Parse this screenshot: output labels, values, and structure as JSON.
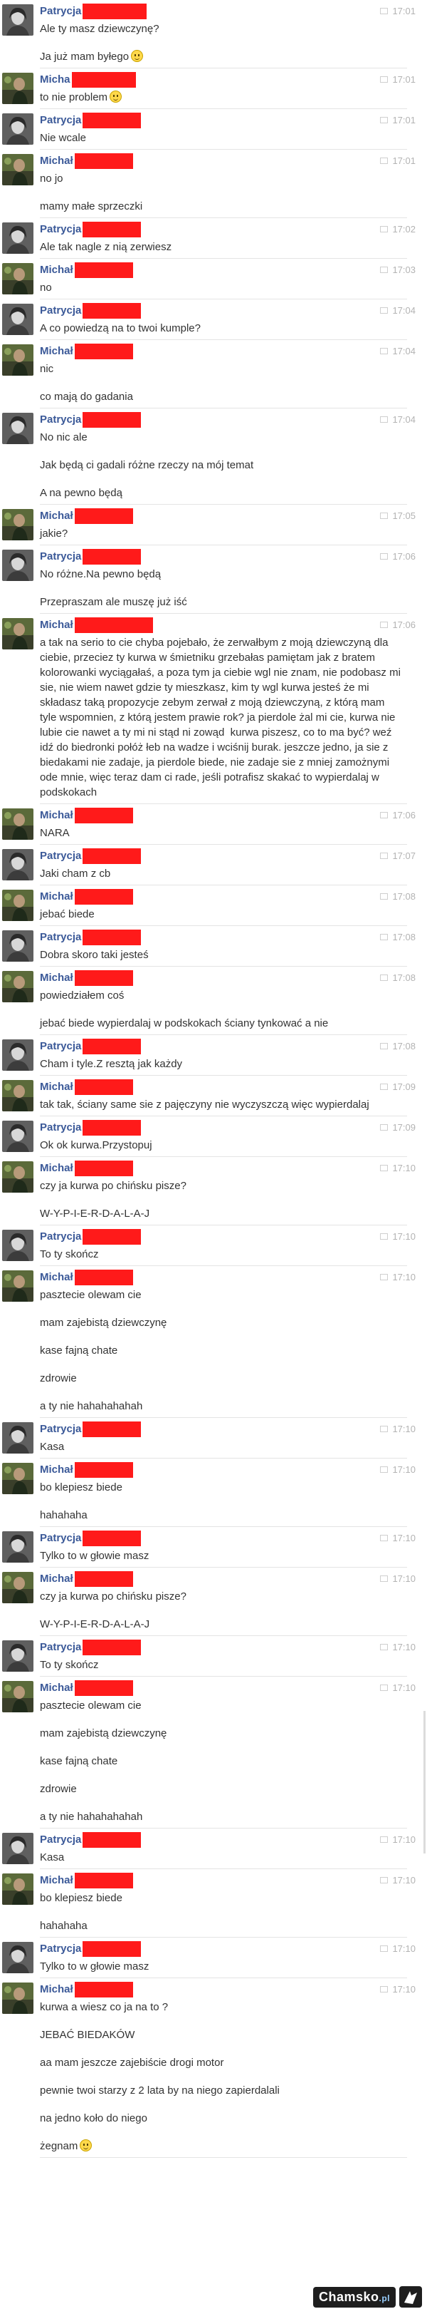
{
  "colors": {
    "sender_name": "#3b5998",
    "redaction": "#ff1a1a",
    "timestamp": "#b3b3b3",
    "message_text": "#333333"
  },
  "messages": [
    {
      "sender": "Patrycja",
      "time": "17:01",
      "avatar": "avatar-patrycja",
      "redact_w": 90,
      "texts": [
        "Ale ty masz dziewczynę?",
        "Ja już mam byłego"
      ],
      "emoji_last": true
    },
    {
      "sender": "Micha",
      "time": "17:01",
      "avatar": "avatar-michal",
      "redact_w": 90,
      "texts": [
        "to nie problem"
      ]
    },
    {
      "sender": "Patrycja",
      "time": "17:01",
      "avatar": "avatar-patrycja",
      "redact_w": 82,
      "texts": [
        "Nie wcale"
      ]
    },
    {
      "sender": "Michał",
      "time": "17:01",
      "avatar": "avatar-michal",
      "redact_w": 82,
      "texts": [
        "no jo",
        "mamy małe sprzeczki"
      ]
    },
    {
      "sender": "Patrycja",
      "time": "17:02",
      "avatar": "avatar-patrycja",
      "redact_w": 82,
      "texts": [
        "Ale tak nagle z nią zerwiesz"
      ]
    },
    {
      "sender": "Michał",
      "time": "17:03",
      "avatar": "avatar-michal",
      "redact_w": 82,
      "texts": [
        "no"
      ]
    },
    {
      "sender": "Patrycja",
      "time": "17:04",
      "avatar": "avatar-patrycja",
      "redact_w": 82,
      "texts": [
        "A co powiedzą na to twoi kumple?"
      ]
    },
    {
      "sender": "Michał",
      "time": "17:04",
      "avatar": "avatar-michal",
      "redact_w": 82,
      "texts": [
        "nic",
        "co mają do gadania"
      ]
    },
    {
      "sender": "Patrycja",
      "time": "17:04",
      "avatar": "avatar-patrycja",
      "redact_w": 82,
      "texts": [
        "No nic ale",
        "Jak będą ci gadali różne rzeczy na mój temat",
        "A na pewno będą"
      ]
    },
    {
      "sender": "Michał",
      "time": "17:05",
      "avatar": "avatar-michal",
      "redact_w": 82,
      "texts": [
        "jakie?"
      ]
    },
    {
      "sender": "Patrycja",
      "time": "17:06",
      "avatar": "avatar-patrycja",
      "redact_w": 82,
      "texts": [
        "No różne.Na pewno będą",
        "Przepraszam ale muszę już iść"
      ]
    },
    {
      "sender": "Michał",
      "time": "17:06",
      "avatar": "avatar-michal",
      "redact_w": 110,
      "texts": [
        "a tak na serio to cie chyba pojebało, że zerwałbym z moją dziewczyną dla ciebie, przeciez ty kurwa w śmietniku grzebałas pamiętam jak z bratem kolorowanki wyciągałaś, a poza tym ja ciebie wgl nie znam, nie podobasz mi sie, nie wiem nawet gdzie ty mieszkasz, kim ty wgl kurwa jesteś że mi składasz taką propozycje zebym zerwał z moją dziewczyną, z którą mam tyle wspomnien, z którą jestem prawie rok? ja pierdole żal mi cie, kurwa nie lubie cie nawet a ty mi ni stąd ni zowąd  kurwa piszesz, co to ma być? weź idź do biedronki połóż łeb na wadze i wciśnij burak. jeszcze jedno, ja sie z biedakami nie zadaje, ja pierdole biede, nie zadaje sie z mniej zamożnymi ode mnie, więc teraz dam ci rade, jeśli potrafisz skakać to wypierdalaj w podskokach"
      ]
    },
    {
      "sender": "Michał",
      "time": "17:06",
      "avatar": "avatar-michal",
      "redact_w": 82,
      "texts": [
        "NARA"
      ]
    },
    {
      "sender": "Patrycja",
      "time": "17:07",
      "avatar": "avatar-patrycja",
      "redact_w": 82,
      "texts": [
        "Jaki cham z cb"
      ]
    },
    {
      "sender": "Michał",
      "time": "17:08",
      "avatar": "avatar-michal",
      "redact_w": 82,
      "texts": [
        "jebać biede"
      ]
    },
    {
      "sender": "Patrycja",
      "time": "17:08",
      "avatar": "avatar-patrycja",
      "redact_w": 82,
      "texts": [
        "Dobra skoro taki jesteś"
      ]
    },
    {
      "sender": "Michał",
      "time": "17:08",
      "avatar": "avatar-michal",
      "redact_w": 82,
      "texts": [
        "powiedziałem coś",
        "jebać biede wypierdalaj w podskokach ściany tynkować a nie"
      ]
    },
    {
      "sender": "Patrycja",
      "time": "17:08",
      "avatar": "avatar-patrycja",
      "redact_w": 82,
      "texts": [
        "Cham i tyle.Z resztą jak każdy"
      ]
    },
    {
      "sender": "Michał",
      "time": "17:09",
      "avatar": "avatar-michal",
      "redact_w": 82,
      "texts": [
        "tak tak, ściany same sie z pajęczyny nie wyczyszczą więc wypierdalaj"
      ]
    },
    {
      "sender": "Patrycja",
      "time": "17:09",
      "avatar": "avatar-patrycja",
      "redact_w": 82,
      "texts": [
        "Ok ok kurwa.Przystopuj"
      ]
    },
    {
      "sender": "Michał",
      "time": "17:10",
      "avatar": "avatar-michal",
      "redact_w": 82,
      "texts": [
        "czy ja kurwa po chińsku pisze?",
        "W-Y-P-I-E-R-D-A-L-A-J"
      ]
    },
    {
      "sender": "Patrycja",
      "time": "17:10",
      "avatar": "avatar-patrycja",
      "redact_w": 82,
      "texts": [
        "To ty skończ"
      ]
    },
    {
      "sender": "Michał",
      "time": "17:10",
      "avatar": "avatar-michal",
      "redact_w": 82,
      "texts": [
        "pasztecie olewam cie",
        "mam zajebistą dziewczynę",
        "kase fajną chate",
        "zdrowie",
        "a ty nie hahahahahah"
      ]
    },
    {
      "sender": "Patrycja",
      "time": "17:10",
      "avatar": "avatar-patrycja",
      "redact_w": 82,
      "texts": [
        "Kasa"
      ]
    },
    {
      "sender": "Michał",
      "time": "17:10",
      "avatar": "avatar-michal",
      "redact_w": 82,
      "texts": [
        "bo klepiesz biede",
        "hahahaha"
      ]
    },
    {
      "sender": "Patrycja",
      "time": "17:10",
      "avatar": "avatar-patrycja",
      "redact_w": 82,
      "texts": [
        "Tylko to w głowie masz"
      ]
    },
    {
      "sender": "Michał",
      "time": "17:10",
      "avatar": "avatar-michal",
      "redact_w": 82,
      "texts": [
        "czy ja kurwa po chińsku pisze?",
        "W-Y-P-I-E-R-D-A-L-A-J"
      ]
    },
    {
      "sender": "Patrycja",
      "time": "17:10",
      "avatar": "avatar-patrycja",
      "redact_w": 82,
      "texts": [
        "To ty skończ"
      ]
    },
    {
      "sender": "Michał",
      "time": "17:10",
      "avatar": "avatar-michal",
      "redact_w": 82,
      "texts": [
        "pasztecie olewam cie",
        "mam zajebistą dziewczynę",
        "kase fajną chate",
        "zdrowie",
        "a ty nie hahahahahah"
      ]
    },
    {
      "sender": "Patrycja",
      "time": "17:10",
      "avatar": "avatar-patrycja",
      "redact_w": 82,
      "texts": [
        "Kasa"
      ]
    },
    {
      "sender": "Michał",
      "time": "17:10",
      "avatar": "avatar-michal",
      "redact_w": 82,
      "texts": [
        "bo klepiesz biede",
        "hahahaha"
      ]
    },
    {
      "sender": "Patrycja",
      "time": "17:10",
      "avatar": "avatar-patrycja",
      "redact_w": 82,
      "texts": [
        "Tylko to w głowie masz"
      ]
    },
    {
      "sender": "Michał",
      "time": "17:10",
      "avatar": "avatar-michal",
      "redact_w": 82,
      "texts": [
        "kurwa a wiesz co ja na to ?",
        "JEBAĆ BIEDAKÓW",
        "aa mam jeszcze zajebiście drogi motor",
        "pewnie twoi starzy z 2 lata by na niego zapierdalali",
        "na jedno koło do niego",
        "żegnam"
      ],
      "emoji_last": true
    }
  ],
  "watermark": {
    "text": "Chamsko",
    "suffix": ".pl"
  }
}
